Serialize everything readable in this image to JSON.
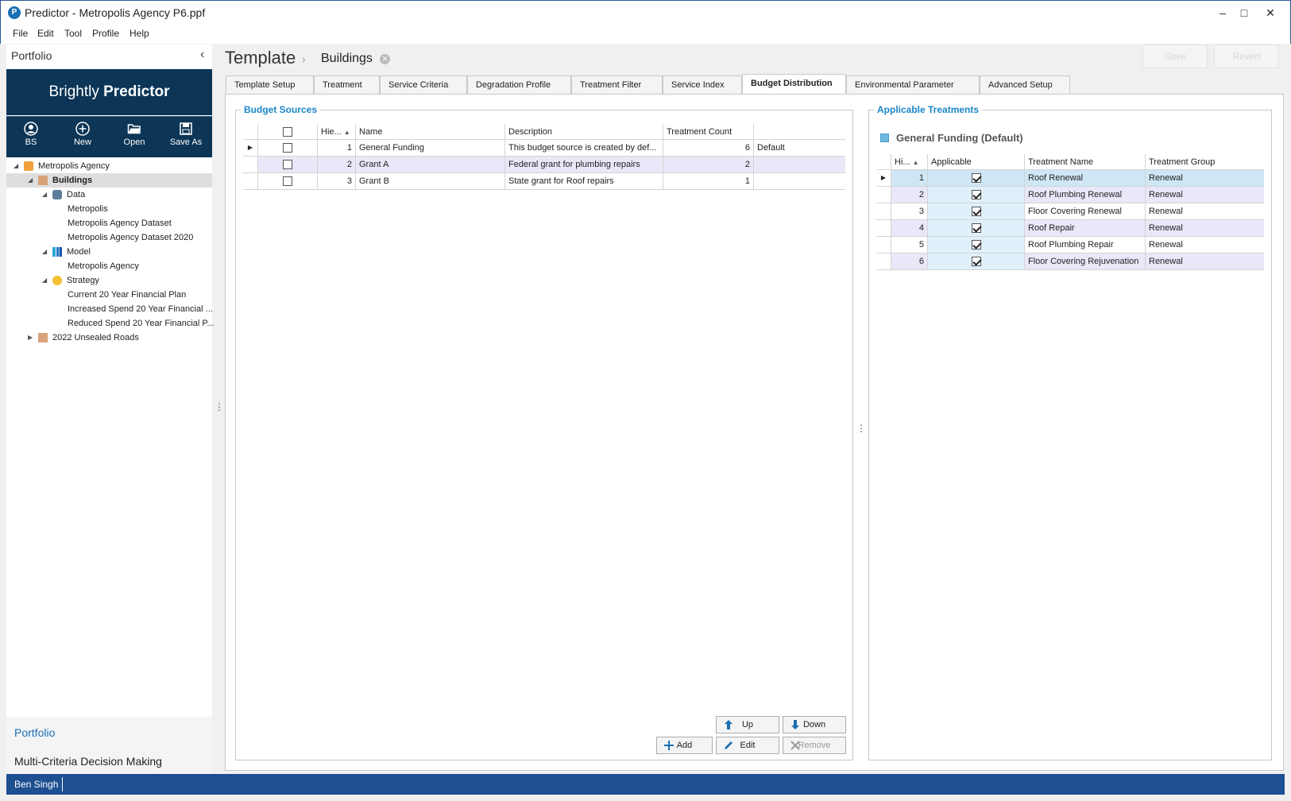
{
  "window": {
    "title": "Predictor - Metropolis Agency P6.ppf",
    "app_icon": "predictor-logo-icon",
    "controls": {
      "minimize": "–",
      "maximize": "□",
      "close": "✕"
    }
  },
  "menu": [
    "File",
    "Edit",
    "Tool",
    "Profile",
    "Help"
  ],
  "left_panel": {
    "header": "Portfolio",
    "brand_light": "Brightly ",
    "brand_bold": "Predictor",
    "toolbar": [
      {
        "label": "BS",
        "icon": "user-icon"
      },
      {
        "label": "New",
        "icon": "plus-circle-icon"
      },
      {
        "label": "Open",
        "icon": "folder-open-icon"
      },
      {
        "label": "Save As",
        "icon": "save-icon"
      }
    ],
    "tree": [
      {
        "label": "Metropolis Agency",
        "icon": "agency-icon"
      },
      {
        "label": "Buildings",
        "icon": "portfolio-icon"
      },
      {
        "label": "Data",
        "icon": "database-icon"
      },
      {
        "label": "Metropolis"
      },
      {
        "label": "Metropolis Agency Dataset"
      },
      {
        "label": "Metropolis Agency Dataset 2020"
      },
      {
        "label": "Model",
        "icon": "model-icon"
      },
      {
        "label": "Metropolis Agency"
      },
      {
        "label": "Strategy",
        "icon": "strategy-icon"
      },
      {
        "label": "Current 20 Year Financial Plan"
      },
      {
        "label": "Increased Spend 20 Year Financial ..."
      },
      {
        "label": "Reduced Spend 20 Year Financial P..."
      },
      {
        "label": "2022 Unsealed Roads",
        "icon": "portfolio-icon"
      }
    ],
    "nav": [
      "Portfolio",
      "Multi-Criteria Decision Making"
    ]
  },
  "header": {
    "breadcrumb_root": "Template",
    "breadcrumb_sep": "›",
    "breadcrumb_current": "Buildings",
    "save_label": "Save",
    "revert_label": "Revert"
  },
  "tabs": [
    "Template Setup",
    "Treatment",
    "Service Criteria",
    "Degradation Profile",
    "Treatment Filter",
    "Service Index",
    "Budget Distribution",
    "Environmental Parameter",
    "Advanced Setup"
  ],
  "active_tab": "Budget Distribution",
  "budget_sources": {
    "title": "Budget Sources",
    "columns": [
      "Hie...",
      "Name",
      "Description",
      "Treatment Count",
      ""
    ],
    "rows": [
      {
        "hie": "1",
        "name": "General Funding",
        "description": "This budget source is created by def...",
        "count": "6",
        "extra": "Default"
      },
      {
        "hie": "2",
        "name": "Grant A",
        "description": "Federal grant for plumbing repairs",
        "count": "2",
        "extra": ""
      },
      {
        "hie": "3",
        "name": "Grant B",
        "description": "State grant for Roof repairs",
        "count": "1",
        "extra": ""
      }
    ],
    "buttons": {
      "up": "Up",
      "down": "Down",
      "add": "Add",
      "edit": "Edit",
      "remove": "Remove"
    }
  },
  "applicable_treatments": {
    "title": "Applicable Treatments",
    "selected_source": "General Funding (Default)",
    "columns": [
      "Hi...",
      "Applicable",
      "Treatment Name",
      "Treatment Group"
    ],
    "rows": [
      {
        "hie": "1",
        "applicable": true,
        "name": "Roof Renewal",
        "group": "Renewal"
      },
      {
        "hie": "2",
        "applicable": true,
        "name": "Roof Plumbing Renewal",
        "group": "Renewal"
      },
      {
        "hie": "3",
        "applicable": true,
        "name": "Floor Covering Renewal",
        "group": "Renewal"
      },
      {
        "hie": "4",
        "applicable": true,
        "name": "Roof Repair",
        "group": "Renewal"
      },
      {
        "hie": "5",
        "applicable": true,
        "name": "Roof Plumbing Repair",
        "group": "Renewal"
      },
      {
        "hie": "6",
        "applicable": true,
        "name": "Floor Covering Rejuvenation",
        "group": "Renewal"
      }
    ]
  },
  "status": {
    "user": "Ben Singh"
  },
  "colors": {
    "brand": "#0c3556",
    "accent": "#1a86c8",
    "status": "#1d4f91"
  }
}
